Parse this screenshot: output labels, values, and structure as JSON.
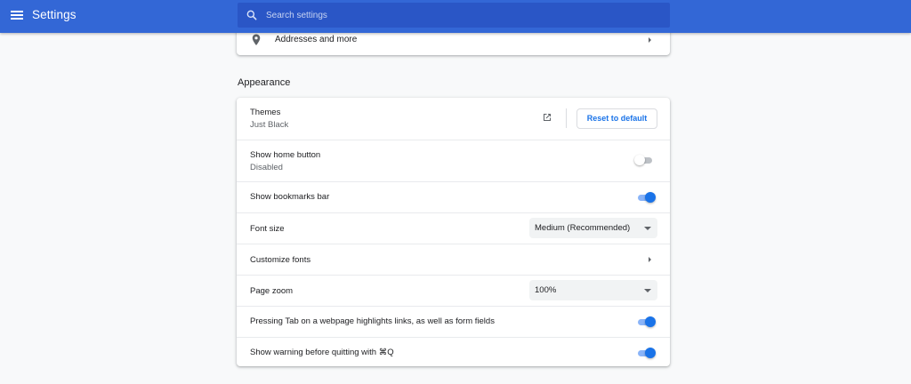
{
  "header": {
    "title": "Settings",
    "menu_icon": "hamburger-menu-icon",
    "search_placeholder": "Search settings",
    "search_icon": "search-icon"
  },
  "autofill": {
    "addresses_label": "Addresses and more",
    "addresses_icon": "location-pin-icon"
  },
  "appearance": {
    "section_title": "Appearance",
    "themes": {
      "label": "Themes",
      "value": "Just Black",
      "open_icon": "open-in-new-icon",
      "reset_label": "Reset to default"
    },
    "home_button": {
      "label": "Show home button",
      "status": "Disabled",
      "enabled": false
    },
    "bookmarks_bar": {
      "label": "Show bookmarks bar",
      "enabled": true
    },
    "font_size": {
      "label": "Font size",
      "selected": "Medium (Recommended)"
    },
    "customize_fonts": {
      "label": "Customize fonts"
    },
    "page_zoom": {
      "label": "Page zoom",
      "selected": "100%"
    },
    "tab_highlights": {
      "label": "Pressing Tab on a webpage highlights links, as well as form fields",
      "enabled": true
    },
    "warn_quit": {
      "label": "Show warning before quitting with ⌘Q",
      "enabled": true
    }
  },
  "colors": {
    "header_bg": "#3367d6",
    "search_bg": "#2a56c6",
    "accent": "#1a73e8",
    "page_bg": "#f8f9fa"
  }
}
